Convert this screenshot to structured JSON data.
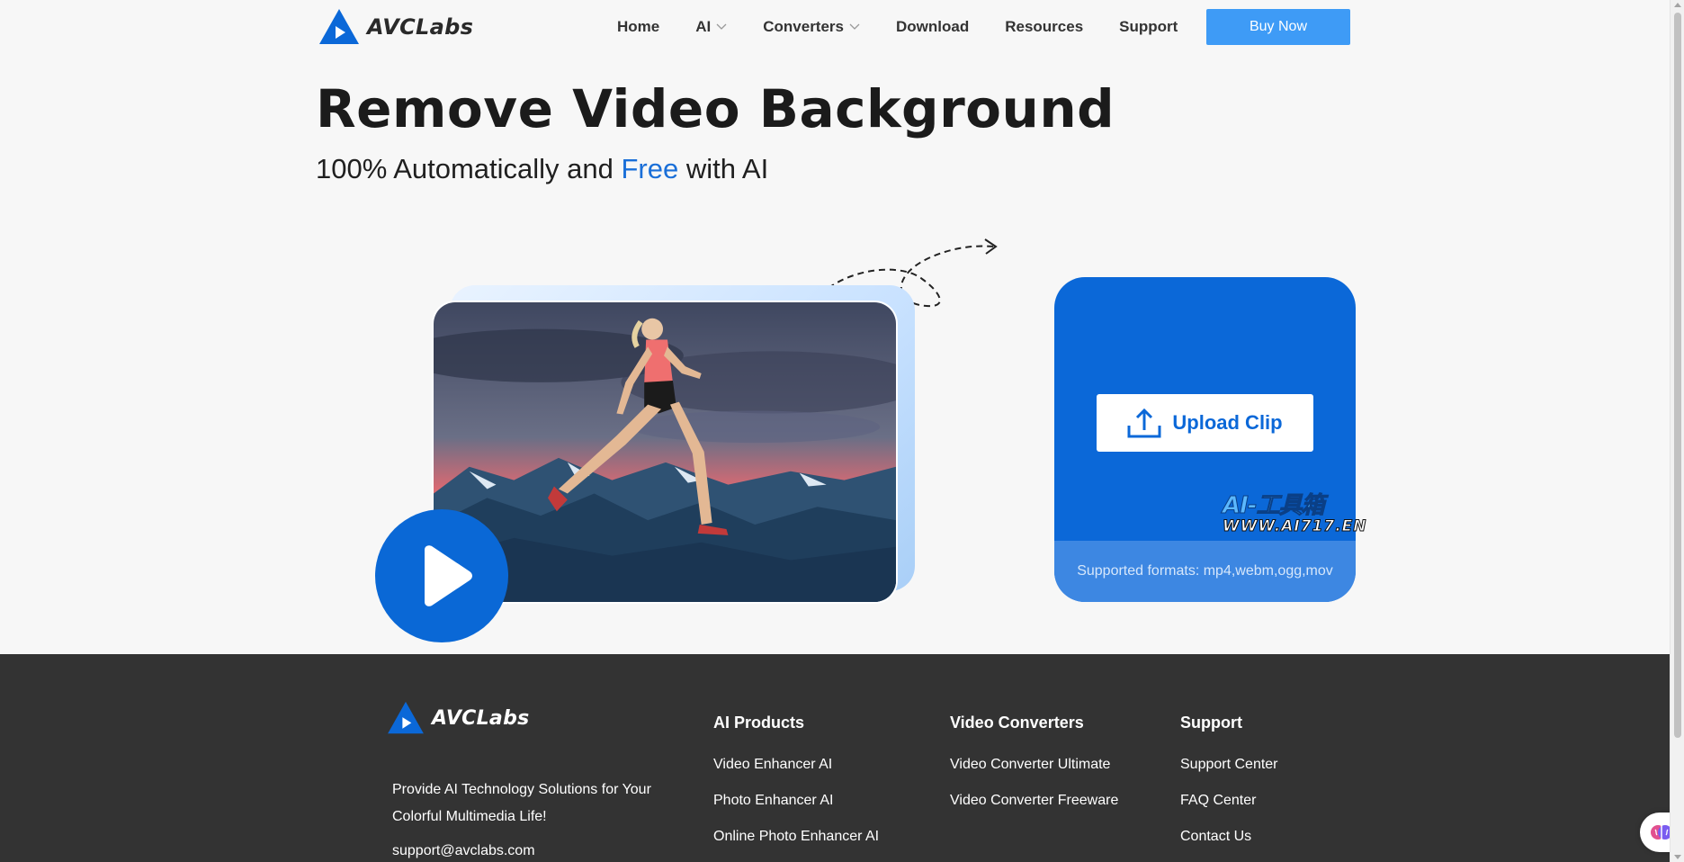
{
  "header": {
    "logo_text": "AVCLabs",
    "nav": [
      {
        "label": "Home"
      },
      {
        "label": "AI"
      },
      {
        "label": "Converters"
      },
      {
        "label": "Download"
      },
      {
        "label": "Resources"
      },
      {
        "label": "Support"
      }
    ],
    "buy_label": "Buy Now"
  },
  "hero": {
    "title": "Remove Video Background",
    "subtitle_pre": "100% Automatically and ",
    "subtitle_free": "Free",
    "subtitle_post": " with AI"
  },
  "upload": {
    "button_label": "Upload Clip",
    "formats": "Supported formats: mp4,webm,ogg,mov"
  },
  "watermark": {
    "top": "AI-工具箱",
    "bottom": "WWW.AI717.EN"
  },
  "footer": {
    "logo_text": "AVCLabs",
    "tagline": "Provide AI Technology Solutions for Your Colorful Multimedia Life!",
    "email": "support@avclabs.com",
    "columns": [
      {
        "title": "AI Products",
        "links": [
          "Video Enhancer AI",
          "Photo Enhancer AI",
          "Online Photo Enhancer AI"
        ]
      },
      {
        "title": "Video Converters",
        "links": [
          "Video Converter Ultimate",
          "Video Converter Freeware"
        ]
      },
      {
        "title": "Support",
        "links": [
          "Support Center",
          "FAQ Center",
          "Contact Us"
        ]
      }
    ]
  },
  "colors": {
    "brand_blue": "#0b68d8",
    "buy_button": "#3e9bf6",
    "free_text": "#1a6fd8",
    "footer_bg": "#333333"
  },
  "icons": [
    "avclabs-logo-icon",
    "chevron-down-icon",
    "play-icon",
    "upload-icon",
    "dashed-arrow-icon",
    "assistant-brain-icon"
  ]
}
